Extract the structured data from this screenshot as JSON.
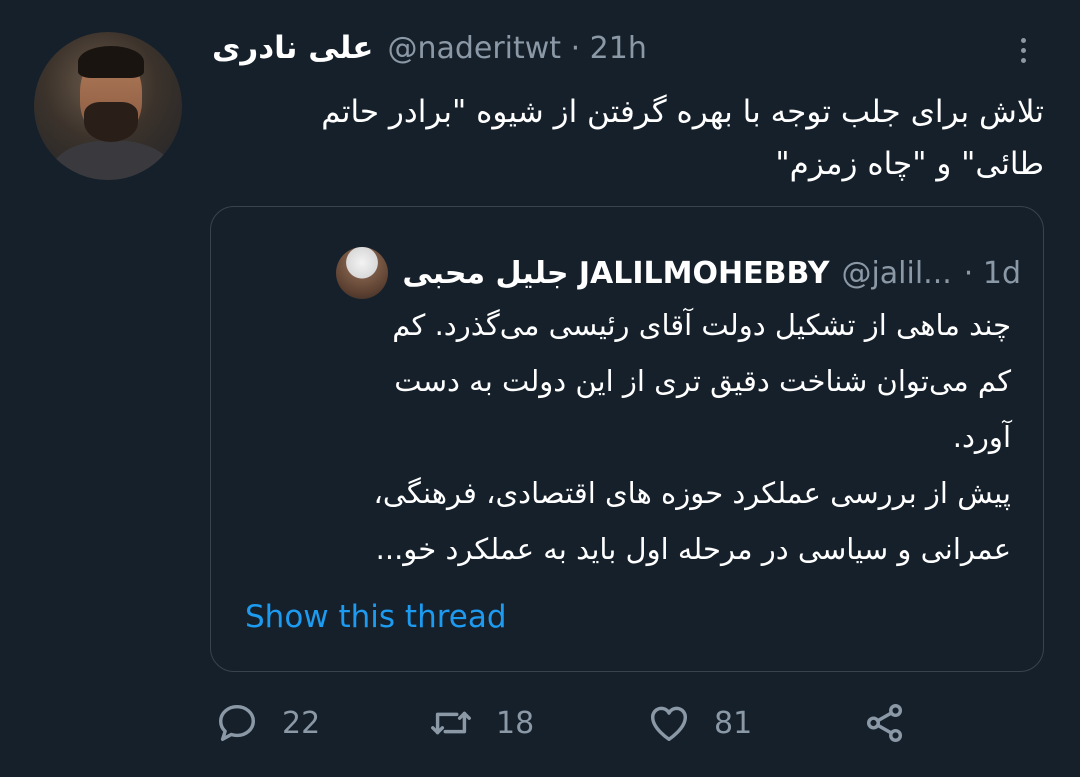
{
  "tweet": {
    "display_name": "علی نادری",
    "handle_time": "@naderitwt · 21h",
    "text": "تلاش برای جلب توجه با بهره گرفتن از شیوه \"برادر حاتم\nطائی\" و \"چاه زمزم\""
  },
  "quoted": {
    "display_name": "جلیل محبی JALILMOHEBBY",
    "handle": "@jalil...",
    "time": "· 1d",
    "text": "چند ماهی از تشکیل دولت آقای رئیسی می‌گذرد. کم\nکم می‌توان شناخت دقیق تری از این دولت به دست\nآورد.\nپیش از بررسی عملکرد حوزه های اقتصادی، فرهنگی،\nعمرانی و سیاسی در مرحله اول باید به عملکرد خو...",
    "show_thread": "Show this thread"
  },
  "actions": {
    "reply_count": "22",
    "retweet_count": "18",
    "like_count": "81"
  },
  "icons": {
    "reply": "reply-icon",
    "retweet": "retweet-icon",
    "like": "heart-icon",
    "share": "share-icon",
    "more": "more-icon"
  },
  "colors": {
    "background": "#15202b",
    "accent": "#1d9bf0",
    "muted": "#8b98a5",
    "border": "#38444d"
  }
}
